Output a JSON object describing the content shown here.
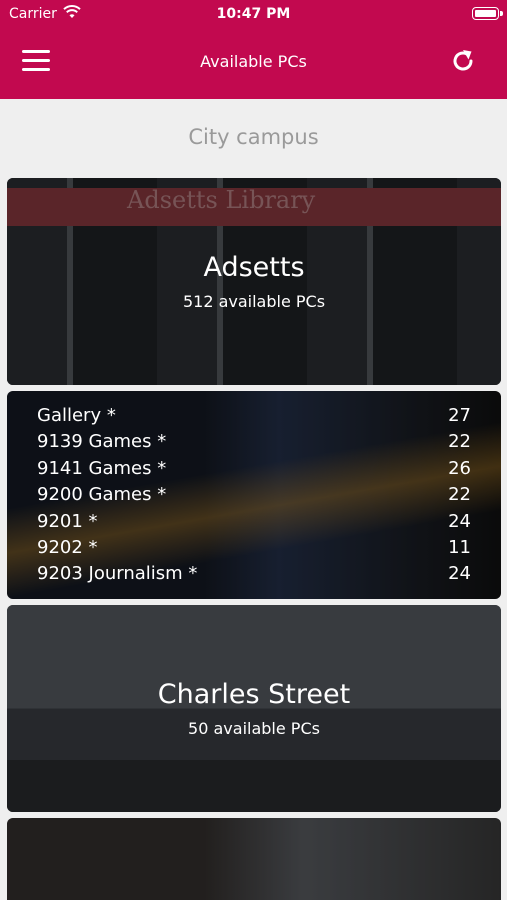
{
  "status_bar": {
    "carrier": "Carrier",
    "time": "10:47 PM"
  },
  "nav": {
    "title": "Available PCs",
    "menu_icon": "hamburger-icon",
    "refresh_icon": "refresh-icon"
  },
  "section": {
    "title": "City campus"
  },
  "buildings": [
    {
      "name": "Adsetts",
      "available": "512 available PCs",
      "sign": "Adsetts Library"
    },
    {
      "name": "Charles Street",
      "available": "50 available PCs"
    }
  ],
  "rooms": [
    {
      "name": "Gallery *",
      "count": "27"
    },
    {
      "name": "9139 Games *",
      "count": "22"
    },
    {
      "name": "9141 Games *",
      "count": "26"
    },
    {
      "name": "9200 Games *",
      "count": "22"
    },
    {
      "name": "9201 *",
      "count": "24"
    },
    {
      "name": "9202 *",
      "count": "11"
    },
    {
      "name": "9203 Journalism *",
      "count": "24"
    }
  ],
  "colors": {
    "brand": "#c2094f",
    "background": "#efefef",
    "section_title": "#9a9a9a"
  }
}
